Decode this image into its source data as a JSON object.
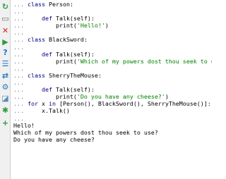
{
  "toolbar": {
    "tools": [
      {
        "name": "rerun-icon",
        "glyph": "↻",
        "color": "#2c9c3c"
      },
      {
        "name": "clear-icon",
        "glyph": "▭",
        "color": "#6a6a6a"
      },
      {
        "name": "close-icon",
        "glyph": "✕",
        "color": "#d92020"
      },
      {
        "name": "run-icon",
        "glyph": "▶",
        "color": "#2c9c3c"
      },
      {
        "name": "help-icon",
        "glyph": "?",
        "color": "#1a73c8"
      },
      {
        "name": "history-icon",
        "glyph": "☰",
        "color": "#1a73c8"
      },
      {
        "name": "soft-wrap-icon",
        "glyph": "⇄",
        "color": "#1a73c8"
      },
      {
        "name": "settings-icon",
        "glyph": "⚙",
        "color": "#2b7fc0"
      },
      {
        "name": "variables-icon",
        "glyph": "◪",
        "color": "#5a8bbd"
      },
      {
        "name": "debug-icon",
        "glyph": "✱",
        "color": "#2c9c3c"
      },
      {
        "name": "add-icon",
        "glyph": "+",
        "color": "#2c9c3c"
      }
    ]
  },
  "console": {
    "prompt_cont": "...",
    "prompt_main": ">>>",
    "lines": [
      {
        "p": "...",
        "code": [
          {
            "t": "kw",
            "v": "class "
          },
          {
            "t": "txt",
            "v": "Person:"
          }
        ]
      },
      {
        "p": "...",
        "code": []
      },
      {
        "p": "...",
        "code": [
          {
            "t": "txt",
            "v": "    "
          },
          {
            "t": "kw",
            "v": "def "
          },
          {
            "t": "txt",
            "v": "Talk(self):"
          }
        ]
      },
      {
        "p": "...",
        "code": [
          {
            "t": "txt",
            "v": "        print("
          },
          {
            "t": "str",
            "v": "'Hello!'"
          },
          {
            "t": "txt",
            "v": ")"
          }
        ]
      },
      {
        "p": "...",
        "code": []
      },
      {
        "p": "...",
        "code": [
          {
            "t": "kw",
            "v": "class "
          },
          {
            "t": "txt",
            "v": "BlackSword:"
          }
        ]
      },
      {
        "p": "...",
        "code": []
      },
      {
        "p": "...",
        "code": [
          {
            "t": "txt",
            "v": "    "
          },
          {
            "t": "kw",
            "v": "def "
          },
          {
            "t": "txt",
            "v": "Talk(self):"
          }
        ]
      },
      {
        "p": "...",
        "code": [
          {
            "t": "txt",
            "v": "        print("
          },
          {
            "t": "str",
            "v": "'Which of my powers dost thou seek to use?'"
          },
          {
            "t": "txt",
            "v": ")"
          }
        ]
      },
      {
        "p": "...",
        "code": []
      },
      {
        "p": "...",
        "code": [
          {
            "t": "kw",
            "v": "class "
          },
          {
            "t": "txt",
            "v": "SherryTheMouse:"
          }
        ]
      },
      {
        "p": "...",
        "code": []
      },
      {
        "p": "...",
        "code": [
          {
            "t": "txt",
            "v": "    "
          },
          {
            "t": "kw",
            "v": "def "
          },
          {
            "t": "txt",
            "v": "Talk(self):"
          }
        ]
      },
      {
        "p": "...",
        "code": [
          {
            "t": "txt",
            "v": "        print("
          },
          {
            "t": "str",
            "v": "'Do you have any cheese?'"
          },
          {
            "t": "txt",
            "v": ")"
          }
        ]
      },
      {
        "p": "...",
        "code": [
          {
            "t": "kw",
            "v": "for "
          },
          {
            "t": "txt",
            "v": "x "
          },
          {
            "t": "kw",
            "v": "in "
          },
          {
            "t": "txt",
            "v": "[Person(), BlackSword(), SherryTheMouse()]:"
          }
        ]
      },
      {
        "p": "...",
        "code": [
          {
            "t": "txt",
            "v": "    x.Talk()"
          }
        ]
      },
      {
        "p": "...",
        "code": []
      }
    ],
    "output": [
      "Hello!",
      "Which of my powers dost thou seek to use?",
      "Do you have any cheese?"
    ],
    "input_value": ""
  }
}
